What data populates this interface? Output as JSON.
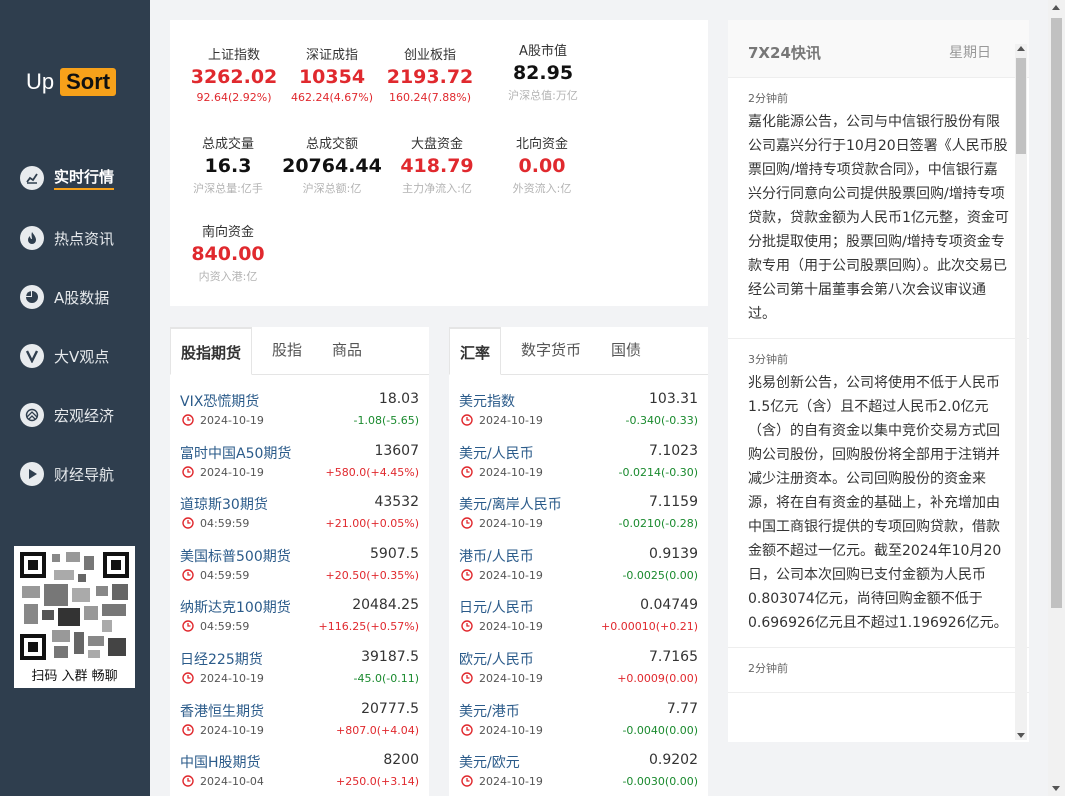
{
  "logo": {
    "up": "Up",
    "sort": "Sort"
  },
  "nav": [
    {
      "label": "实时行情",
      "icon": "chart-icon",
      "active": true
    },
    {
      "label": "热点资讯",
      "icon": "flame-icon",
      "active": false
    },
    {
      "label": "A股数据",
      "icon": "pie-icon",
      "active": false
    },
    {
      "label": "大V观点",
      "icon": "v-icon",
      "active": false
    },
    {
      "label": "宏观经济",
      "icon": "globe-icon",
      "active": false
    },
    {
      "label": "财经导航",
      "icon": "play-icon",
      "active": false
    }
  ],
  "qr": {
    "caption": "扫码 入群 畅聊"
  },
  "indices": [
    {
      "name": "上证指数",
      "value": "3262.02",
      "sub": "92.64(2.92%)",
      "color": "#e0292e",
      "subcolor": "#e0292e"
    },
    {
      "name": "深证成指",
      "value": "10354",
      "sub": "462.24(4.67%)",
      "color": "#e0292e",
      "subcolor": "#e0292e"
    },
    {
      "name": "创业板指",
      "value": "2193.72",
      "sub": "160.24(7.88%)",
      "color": "#e0292e",
      "subcolor": "#e0292e"
    },
    {
      "name": "A股市值",
      "value": "82.95",
      "sub": "沪深总值:万亿",
      "color": "#111111",
      "subcolor": "#b3b3b3"
    },
    {
      "name": "总成交量",
      "value": "16.3",
      "sub": "沪深总量:亿手",
      "color": "#111111",
      "subcolor": "#b3b3b3"
    },
    {
      "name": "总成交额",
      "value": "20764.44",
      "sub": "沪深总额:亿",
      "color": "#111111",
      "subcolor": "#b3b3b3"
    },
    {
      "name": "大盘资金",
      "value": "418.79",
      "sub": "主力净流入:亿",
      "color": "#e0292e",
      "subcolor": "#b3b3b3"
    },
    {
      "name": "北向资金",
      "value": "0.00",
      "sub": "外资流入:亿",
      "color": "#e0292e",
      "subcolor": "#b3b3b3"
    },
    {
      "name": "南向资金",
      "value": "840.00",
      "sub": "内资入港:亿",
      "color": "#e0292e",
      "subcolor": "#b3b3b3"
    }
  ],
  "futures": {
    "tabs": [
      "股指期货",
      "股指",
      "商品"
    ],
    "rows": [
      {
        "name": "VIX恐慌期货",
        "value": "18.03",
        "time": "2024-10-19",
        "change": "-1.08(-5.65)",
        "dir": "down"
      },
      {
        "name": "富时中国A50期货",
        "value": "13607",
        "time": "2024-10-19",
        "change": "+580.0(+4.45%)",
        "dir": "up"
      },
      {
        "name": "道琼斯30期货",
        "value": "43532",
        "time": "04:59:59",
        "change": "+21.00(+0.05%)",
        "dir": "up"
      },
      {
        "name": "美国标普500期货",
        "value": "5907.5",
        "time": "04:59:59",
        "change": "+20.50(+0.35%)",
        "dir": "up"
      },
      {
        "name": "纳斯达克100期货",
        "value": "20484.25",
        "time": "04:59:59",
        "change": "+116.25(+0.57%)",
        "dir": "up"
      },
      {
        "name": "日经225期货",
        "value": "39187.5",
        "time": "2024-10-19",
        "change": "-45.0(-0.11)",
        "dir": "down"
      },
      {
        "name": "香港恒生期货",
        "value": "20777.5",
        "time": "2024-10-19",
        "change": "+807.0(+4.04)",
        "dir": "up"
      },
      {
        "name": "中国H股期货",
        "value": "8200",
        "time": "2024-10-04",
        "change": "+250.0(+3.14)",
        "dir": "up"
      }
    ]
  },
  "fx": {
    "tabs": [
      "汇率",
      "数字货币",
      "国债"
    ],
    "rows": [
      {
        "name": "美元指数",
        "value": "103.31",
        "time": "2024-10-19",
        "change": "-0.340(-0.33)",
        "dir": "down"
      },
      {
        "name": "美元/人民币",
        "value": "7.1023",
        "time": "2024-10-19",
        "change": "-0.0214(-0.30)",
        "dir": "down"
      },
      {
        "name": "美元/离岸人民币",
        "value": "7.1159",
        "time": "2024-10-19",
        "change": "-0.0210(-0.28)",
        "dir": "down"
      },
      {
        "name": "港币/人民币",
        "value": "0.9139",
        "time": "2024-10-19",
        "change": "-0.0025(0.00)",
        "dir": "down"
      },
      {
        "name": "日元/人民币",
        "value": "0.04749",
        "time": "2024-10-19",
        "change": "+0.00010(+0.21)",
        "dir": "up"
      },
      {
        "name": "欧元/人民币",
        "value": "7.7165",
        "time": "2024-10-19",
        "change": "+0.0009(0.00)",
        "dir": "up"
      },
      {
        "name": "美元/港币",
        "value": "7.77",
        "time": "2024-10-19",
        "change": "-0.0040(0.00)",
        "dir": "down"
      },
      {
        "name": "美元/欧元",
        "value": "0.9202",
        "time": "2024-10-19",
        "change": "-0.0030(0.00)",
        "dir": "down"
      }
    ]
  },
  "news": {
    "title": "7X24快讯",
    "day": "星期日",
    "items": [
      {
        "time": "2分钟前",
        "body": "嘉化能源公告，公司与中信银行股份有限公司嘉兴分行于10月20日签署《人民币股票回购/增持专项贷款合同》，中信银行嘉兴分行同意向公司提供股票回购/增持专项贷款，贷款金额为人民币1亿元整，资金可分批提取使用；股票回购/增持专项资金专款专用（用于公司股票回购）。此次交易已经公司第十届董事会第八次会议审议通过。"
      },
      {
        "time": "3分钟前",
        "body": "兆易创新公告，公司将使用不低于人民币1.5亿元（含）且不超过人民币2.0亿元（含）的自有资金以集中竞价交易方式回购公司股份，回购股份将全部用于注销并减少注册资本。公司回购股份的资金来源，将在自有资金的基础上，补充增加由中国工商银行提供的专项回购贷款，借款金额不超过一亿元。截至2024年10月20日，公司本次回购已支付金额为人民币0.803074亿元，尚待回购金额不低于0.696926亿元且不超过1.196926亿元。"
      },
      {
        "time": "2分钟前",
        "body": ""
      }
    ]
  },
  "colors": {
    "sidebar": "#2f3e4e",
    "accent": "#f7a11a",
    "up": "#e0292e",
    "down": "#1a8a2e"
  }
}
